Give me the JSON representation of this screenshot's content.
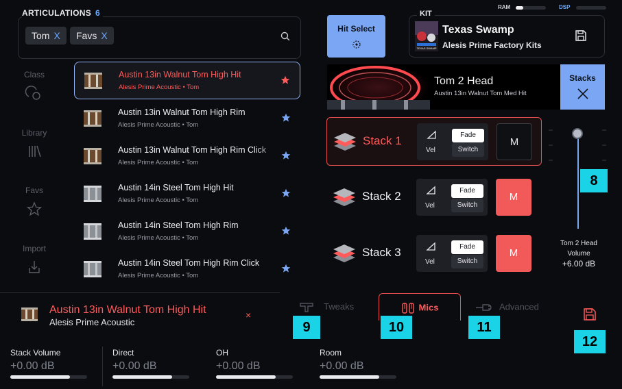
{
  "articulations": {
    "header": "ARTICULATIONS",
    "count": "6",
    "filters": [
      {
        "label": "Tom",
        "remove": "X"
      },
      {
        "label": "Favs",
        "remove": "X"
      }
    ],
    "items": [
      {
        "title": "Austin 13in Walnut Tom High Hit",
        "subtitle": "Alesis Prime Acoustic • Tom",
        "favorite": true,
        "selected": true
      },
      {
        "title": "Austin 13in Walnut Tom High Rim",
        "subtitle": "Alesis Prime Acoustic • Tom",
        "favorite": true,
        "selected": false
      },
      {
        "title": "Austin 13in Walnut Tom High Rim Click",
        "subtitle": "Alesis Prime Acoustic • Tom",
        "favorite": true,
        "selected": false
      },
      {
        "title": "Austin 14in Steel Tom High Hit",
        "subtitle": "Alesis Prime Acoustic • Tom",
        "favorite": true,
        "selected": false
      },
      {
        "title": "Austin 14in Steel Tom High Rim",
        "subtitle": "Alesis Prime Acoustic • Tom",
        "favorite": true,
        "selected": false
      },
      {
        "title": "Austin 14in Steel Tom High Rim Click",
        "subtitle": "Alesis Prime Acoustic • Tom",
        "favorite": true,
        "selected": false
      }
    ]
  },
  "side_nav": [
    {
      "label": "Class",
      "icon": "class-icon"
    },
    {
      "label": "Library",
      "icon": "library-icon"
    },
    {
      "label": "Favs",
      "icon": "star-outline-icon"
    },
    {
      "label": "Import",
      "icon": "import-icon"
    }
  ],
  "hit_select": {
    "label": "Hit Select",
    "icon": "target-icon"
  },
  "kit": {
    "label": "KIT",
    "name": "Texas Swamp",
    "library": "Alesis Prime Factory Kits",
    "thumb_caption": "TEXAS SWAMP"
  },
  "meters": {
    "ram_label": "RAM",
    "dsp_label": "DSP",
    "ram_level": 0.25,
    "dsp_level": 0.0
  },
  "head": {
    "title": "Tom 2 Head",
    "subtitle": "Austin 13in Walnut Tom Med Hit"
  },
  "stacks_button": {
    "label": "Stacks"
  },
  "stacks": [
    {
      "name": "Stack 1",
      "vel": "Vel",
      "fade": "Fade",
      "switch": "Switch",
      "mute": "M",
      "active": true,
      "muted": false
    },
    {
      "name": "Stack 2",
      "vel": "Vel",
      "fade": "Fade",
      "switch": "Switch",
      "mute": "M",
      "active": false,
      "muted": true
    },
    {
      "name": "Stack 3",
      "vel": "Vel",
      "fade": "Fade",
      "switch": "Switch",
      "mute": "M",
      "active": false,
      "muted": true
    }
  ],
  "volume": {
    "label_line1": "Tom 2 Head",
    "label_line2": "Volume",
    "value": "+6.00 dB",
    "level": 1.0
  },
  "selected": {
    "title": "Austin 13in Walnut Tom High Hit",
    "subtitle": "Alesis Prime Acoustic",
    "close": "×"
  },
  "tabs": [
    {
      "label": "Tweaks",
      "active": false
    },
    {
      "label": "Mics",
      "active": true
    },
    {
      "label": "Advanced",
      "active": false
    }
  ],
  "badges": [
    "8",
    "9",
    "10",
    "11",
    "12"
  ],
  "mix": [
    {
      "label": "Stack Volume",
      "value": "+0.00 dB",
      "level": 0.78
    },
    {
      "label": "Direct",
      "value": "+0.00 dB",
      "level": 0.78
    },
    {
      "label": "OH",
      "value": "+0.00 dB",
      "level": 0.78
    },
    {
      "label": "Room",
      "value": "+0.00 dB",
      "level": 0.78
    }
  ],
  "colors": {
    "accent_blue": "#7aa6f4",
    "accent_red": "#f25a5a",
    "badge": "#1bd3e7",
    "background": "#0b0c10"
  }
}
